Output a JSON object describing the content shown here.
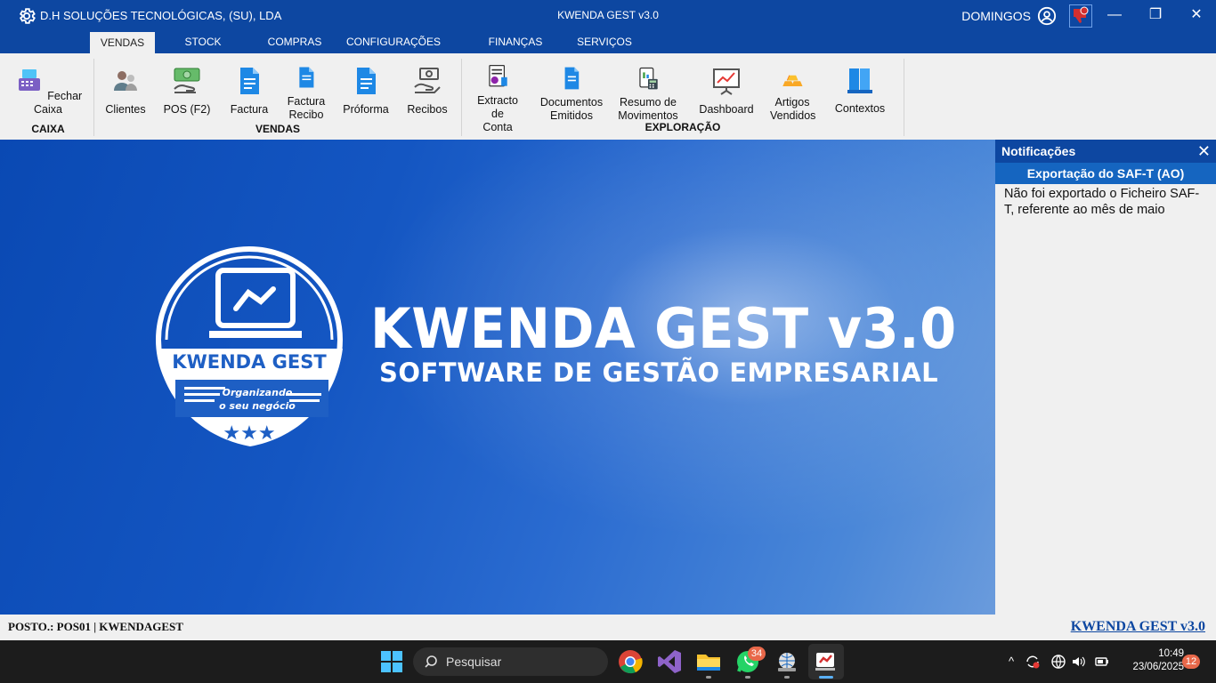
{
  "window": {
    "company": "D.H SOLUÇÕES TECNOLÓGICAS, (SU), LDA",
    "title": "KWENDA GEST v3.0",
    "user": "DOMINGOS",
    "controls": {
      "minimize": "—",
      "restore": "❐",
      "close": "✕"
    }
  },
  "tabs": [
    {
      "label": "VENDAS",
      "active": true
    },
    {
      "label": "STOCK"
    },
    {
      "label": "COMPRAS"
    },
    {
      "label": "CONFIGURAÇÕES"
    },
    {
      "label": "FINANÇAS"
    },
    {
      "label": "SERVIÇOS"
    }
  ],
  "ribbon": {
    "groups": {
      "caixa": "CAIXA",
      "vendas": "VENDAS",
      "exploracao": "EXPLORAÇÃO"
    },
    "buttons": {
      "fechar_caixa": "Fechar Caixa",
      "clientes": "Clientes",
      "pos": "POS (F2)",
      "factura": "Factura",
      "factura_recibo": "Factura Recibo",
      "proforma": "Próforma",
      "recibos": "Recibos",
      "extracto": "Extracto de Conta",
      "documentos": "Documentos Emitidos",
      "resumo": "Resumo de Movimentos",
      "dashboard": "Dashboard",
      "artigos": "Artigos Vendidos",
      "contextos": "Contextos"
    }
  },
  "splash": {
    "headline": "KWENDA GEST v3.0",
    "subline": "SOFTWARE DE GESTÃO EMPRESARIAL",
    "logo_name": "KWENDA GEST",
    "logo_tag1": "Organizando",
    "logo_tag2": "o seu negócio"
  },
  "notifications": {
    "header": "Notificações",
    "close": "✕",
    "item_title": "Exportação do SAF-T (AO)",
    "item_message": "Não foi exportado o Ficheiro SAF-T, referente ao mês de maio"
  },
  "status": {
    "posto": "POSTO.: POS01 | KWENDAGEST",
    "brand": "KWENDA GEST v3.0"
  },
  "taskbar": {
    "search_placeholder": "Pesquisar",
    "whatsapp_badge": "34",
    "notification_count": "12",
    "time": "10:49",
    "date": "23/06/2025"
  },
  "colors": {
    "primary": "#0d47a1",
    "accent": "#1565c0",
    "notif_red": "#d32f2f"
  }
}
